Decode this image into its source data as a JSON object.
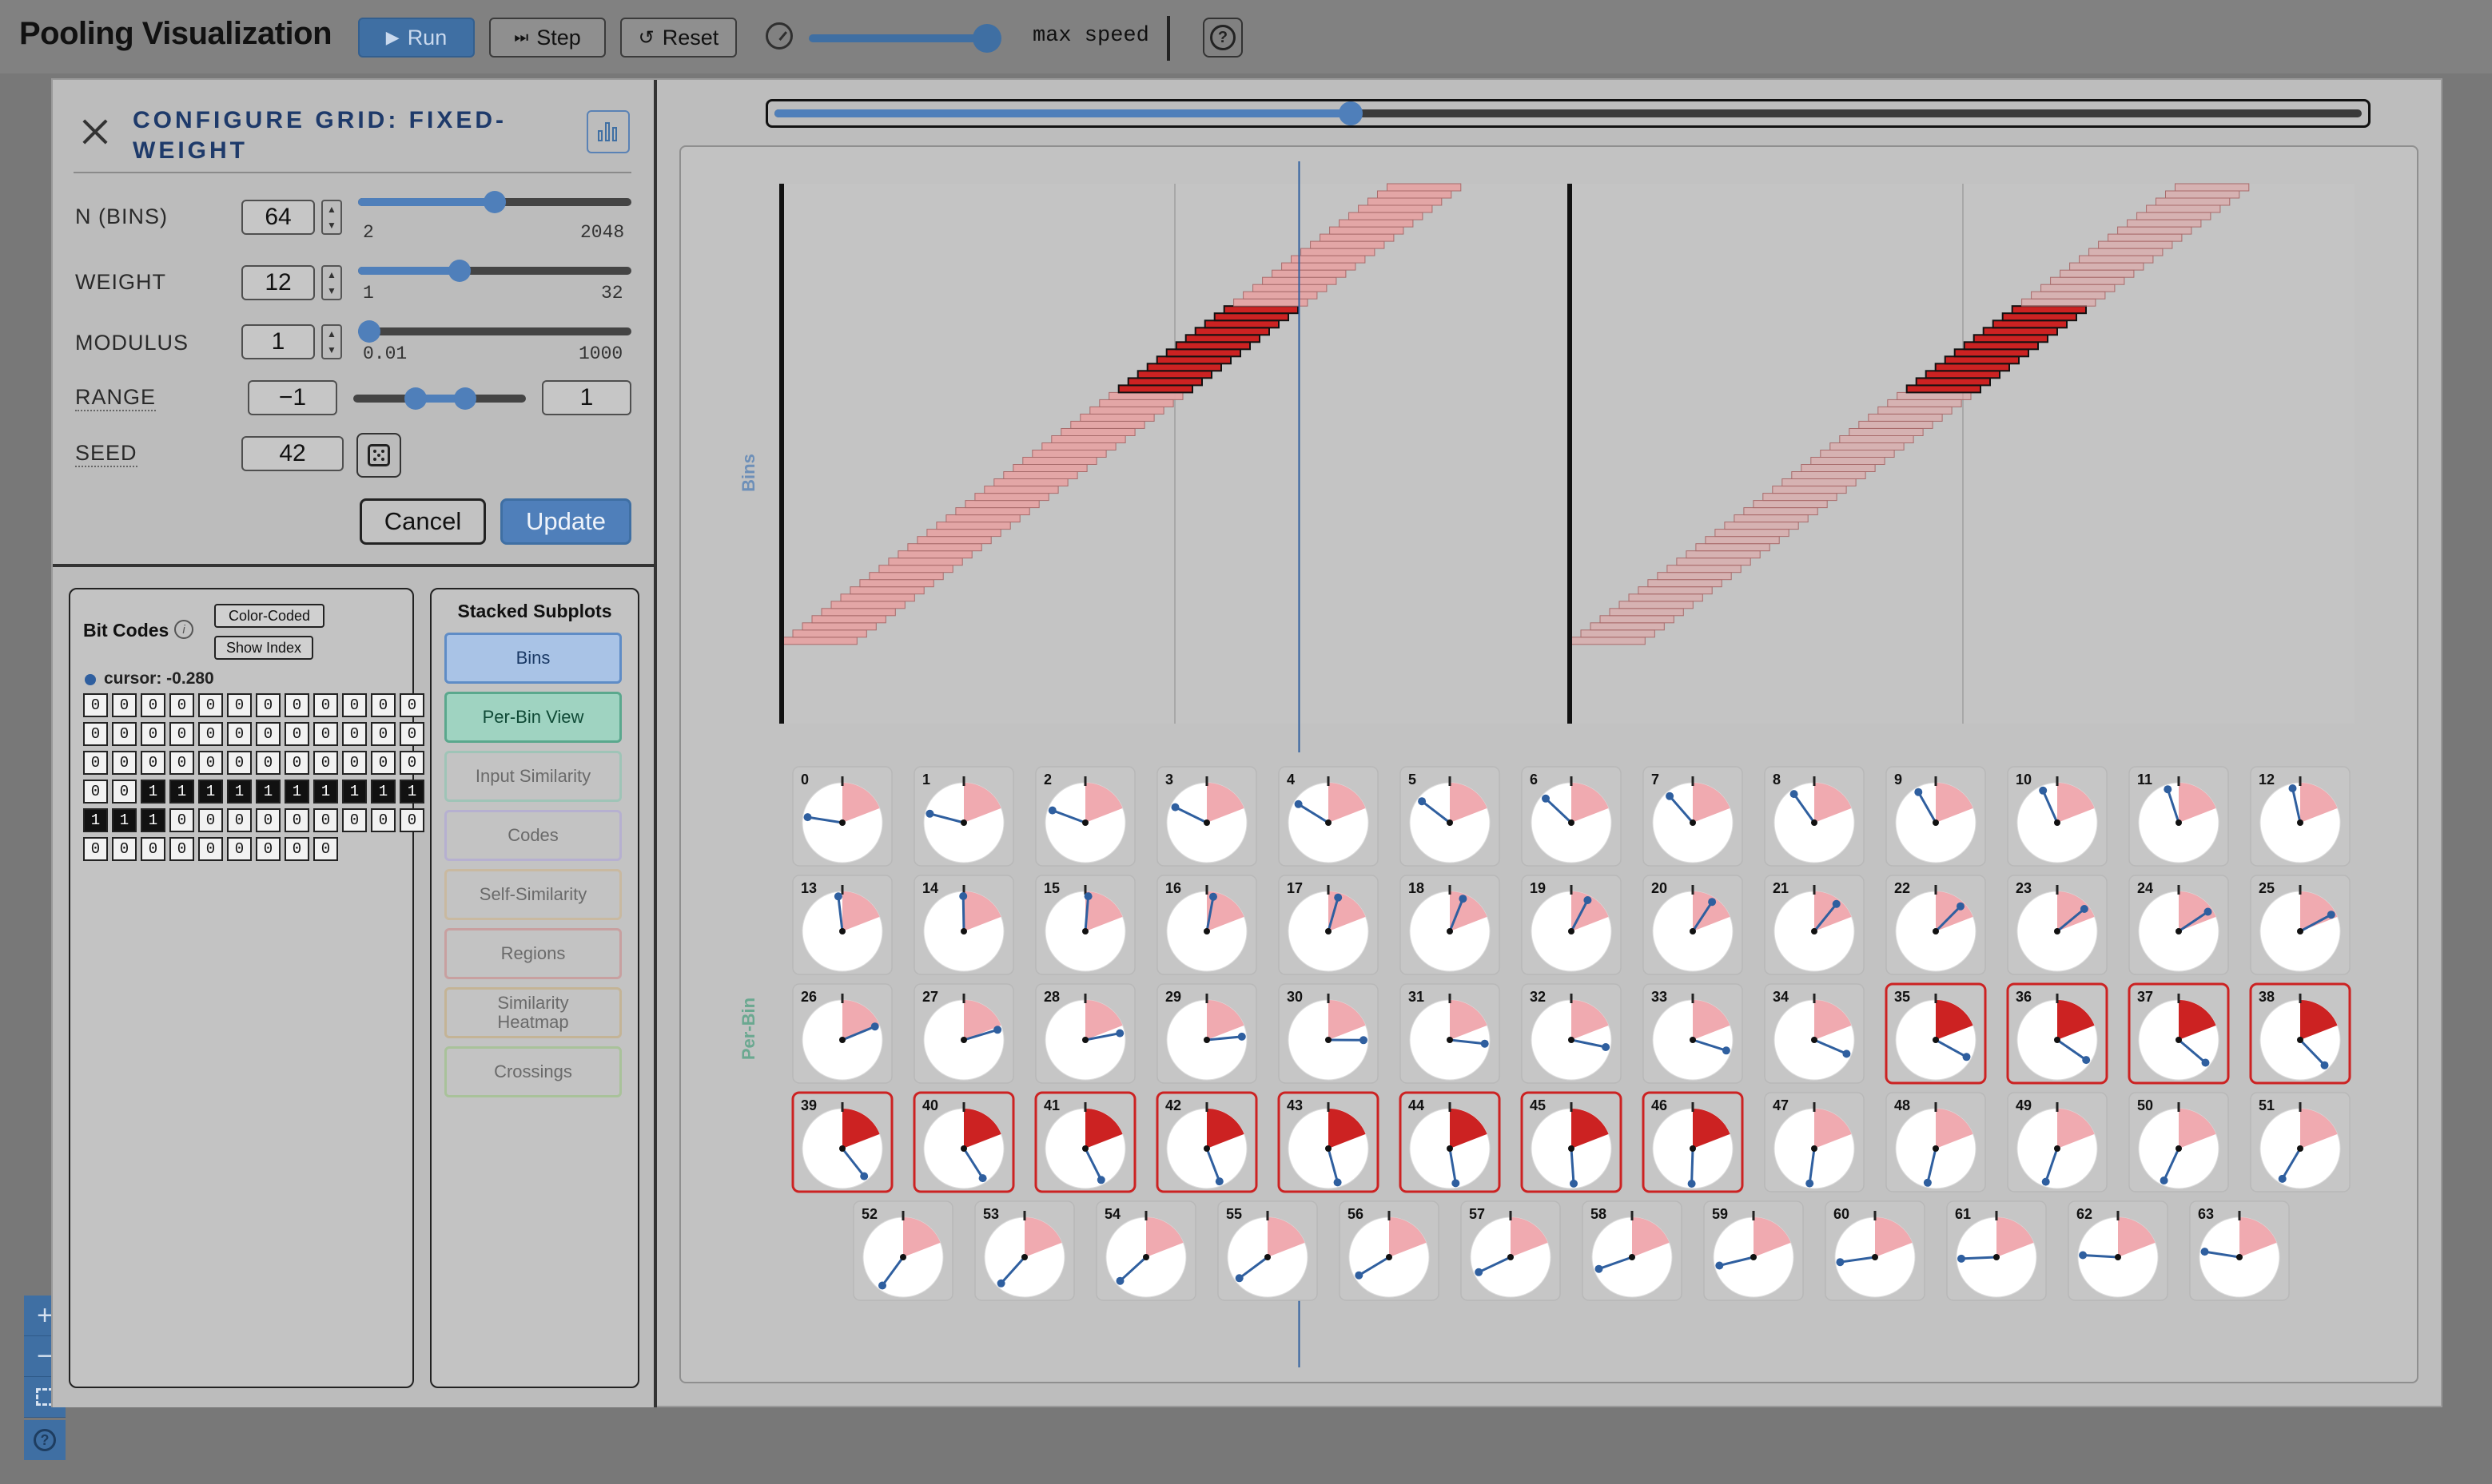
{
  "app": {
    "title": "Pooling Visualization"
  },
  "toolbar": {
    "run_label": "Run",
    "step_label": "Step",
    "reset_label": "Reset",
    "speed_label": "max speed",
    "speed_fraction": 0.97
  },
  "zoom": {
    "plus": "+",
    "minus": "−"
  },
  "config": {
    "title": "CONFIGURE GRID: FIXED-WEIGHT",
    "n_bins": {
      "label": "N (BINS)",
      "value": "64",
      "min": "2",
      "max": "2048",
      "fraction": 0.5
    },
    "weight": {
      "label": "WEIGHT",
      "value": "12",
      "min": "1",
      "max": "32",
      "fraction": 0.37
    },
    "modulus": {
      "label": "MODULUS",
      "value": "1",
      "min": "0.01",
      "max": "1000",
      "fraction": 0.0
    },
    "range": {
      "label": "RANGE",
      "min_value": "−1",
      "max_value": "1"
    },
    "seed": {
      "label": "SEED",
      "value": "42"
    },
    "cancel_label": "Cancel",
    "update_label": "Update"
  },
  "bitcodes": {
    "title": "Bit Codes",
    "info": "i",
    "option_color": "Color-Coded",
    "option_index": "Show Index",
    "cursor_label": "cursor: -0.280",
    "rows": [
      [
        "0",
        "0",
        "0",
        "0",
        "0",
        "0",
        "0",
        "0",
        "0",
        "0",
        "0",
        "0"
      ],
      [
        "0",
        "0",
        "0",
        "0",
        "0",
        "0",
        "0",
        "0",
        "0",
        "0",
        "0",
        "0"
      ],
      [
        "0",
        "0",
        "0",
        "0",
        "0",
        "0",
        "0",
        "0",
        "0",
        "0",
        "0",
        "0"
      ],
      [
        "0",
        "0",
        "1",
        "1",
        "1",
        "1",
        "1",
        "1",
        "1",
        "1",
        "1",
        "1"
      ],
      [
        "1",
        "1",
        "1",
        "0",
        "0",
        "0",
        "0",
        "0",
        "0",
        "0",
        "0",
        "0"
      ],
      [
        "0",
        "0",
        "0",
        "0",
        "0",
        "0",
        "0",
        "0",
        "0"
      ]
    ]
  },
  "subplots": {
    "title": "Stacked Subplots",
    "bins": "Bins",
    "per_bin": "Per-Bin View",
    "input_similarity": "Input Similarity",
    "codes": "Codes",
    "self_similarity": "Self-Similarity",
    "regions": "Regions",
    "similarity_heatmap_1": "Similarity",
    "similarity_heatmap_2": "Heatmap",
    "crossings": "Crossings"
  },
  "timeline": {
    "fraction": 0.363
  },
  "plot": {
    "bins_axis_label": "Bins",
    "perbin_axis_label": "Per-Bin",
    "num_bins": 64,
    "weight": 12,
    "active_first": 35,
    "active_last": 46,
    "colors": {
      "inactive_bar": "#e5a4a4",
      "active_bar": "#cc2222",
      "cursor": "#2f5f9f",
      "gauge_active_border": "#cc2222",
      "gauge_sector": "#f0aab0"
    }
  }
}
